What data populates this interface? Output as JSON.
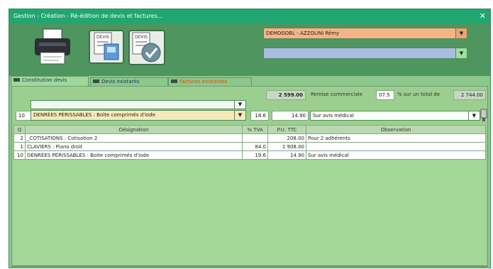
{
  "window": {
    "title": "Gestion - Création - Ré-édition de devis et factures..."
  },
  "titlebar": {
    "close_label": "✕"
  },
  "toolbar": {
    "doc_btn_labels": [
      "DEVIS",
      "DEVIS"
    ],
    "client_value": "DEMOGOBL - AZZOLINI Rémy",
    "second_value": ""
  },
  "tabs": [
    {
      "label": "Constitution devis"
    },
    {
      "label": "Devis existants"
    },
    {
      "label": "Factures existantes"
    }
  ],
  "panel": {
    "total_amount": "2 599.00",
    "remise_label": "Remise commerciale",
    "remise_value": "07.5",
    "total_label": "% sur un total de",
    "total_value": "2 744.00",
    "entry": {
      "qty": "10",
      "designation": "DENRÉES PÉRISSABLES : Boite comprimés d'iode",
      "tax": "18.6",
      "price": "14.90",
      "observation": "Sur avis médical"
    }
  },
  "table": {
    "headers": [
      "Q",
      "Désignation",
      "% TVA",
      "P.U. TTC",
      "Observation"
    ],
    "rows": [
      {
        "q": "2",
        "designation": "_COTISATIONS : Cotisation 2",
        "tva": "",
        "pu": "208.00",
        "obs": "Pour 2 adhérents"
      },
      {
        "q": "1",
        "designation": "CLAVIERS : Piano droit",
        "tva": "84.0",
        "pu": "1 908.00",
        "obs": ""
      },
      {
        "q": "10",
        "designation": "DENRÉES PÉRISSABLES : Boite comprimés d'iode",
        "tva": "19.6",
        "pu": "14.90",
        "obs": "Sur avis médical"
      }
    ]
  }
}
